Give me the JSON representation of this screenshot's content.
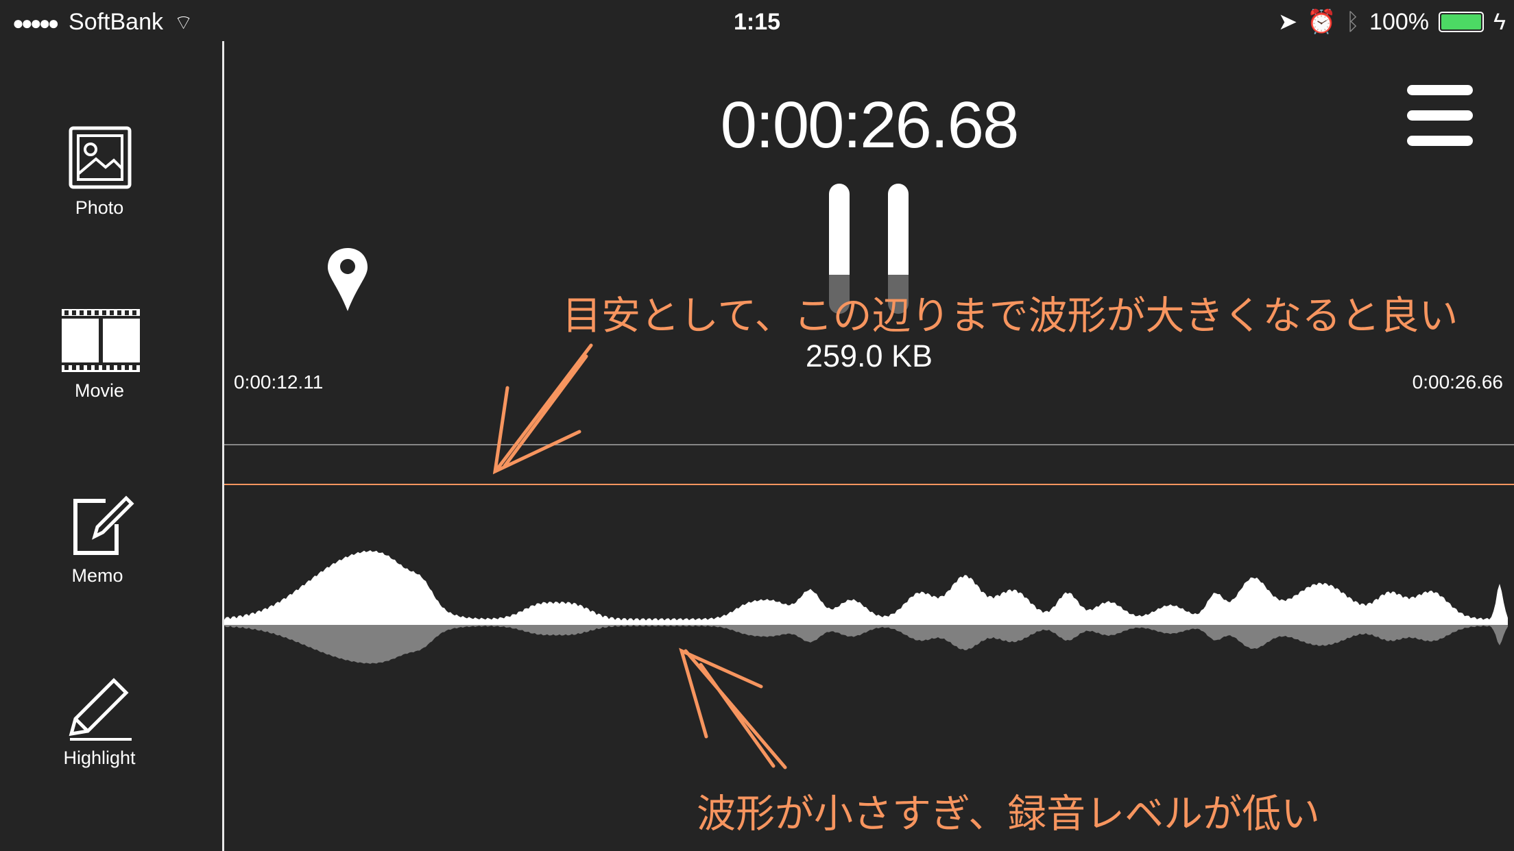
{
  "status_bar": {
    "carrier": "SoftBank",
    "time": "1:15",
    "battery": "100%",
    "battery_color": "#4cd964"
  },
  "sidebar": {
    "items": [
      {
        "label": "Photo",
        "icon": "photo-icon"
      },
      {
        "label": "Movie",
        "icon": "film-icon"
      },
      {
        "label": "Memo",
        "icon": "memo-icon"
      },
      {
        "label": "Highlight",
        "icon": "pencil-icon"
      }
    ]
  },
  "recorder": {
    "elapsed": "0:00:26.68",
    "file_size": "259.0 KB",
    "range_start": "0:00:12.11",
    "range_end": "0:00:26.66"
  },
  "annotations": {
    "top": "目安として、この辺りまで波形が大きくなると良い",
    "bottom": "波形が小さすぎ、録音レベルが低い",
    "color": "#f7955f"
  }
}
